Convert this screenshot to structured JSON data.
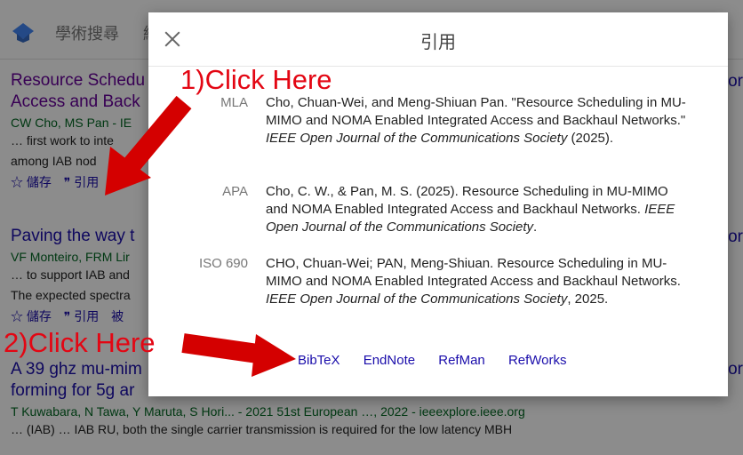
{
  "bg": {
    "brand": "學術搜尋",
    "brand2": "綜",
    "results": [
      {
        "title_1": "Resource Schedu",
        "title_2": "Access and Back",
        "authors": "CW Cho, MS Pan - IE",
        "snip_1": "… first work to inte",
        "snip_2": "among IAB nod",
        "save": "☆ 儲存",
        "cite": "❞ 引用",
        "more": "被"
      },
      {
        "title_1": "Paving the way t",
        "authors": "VF Monteiro, FRM Lir",
        "snip_1": "… to support IAB and",
        "snip_2": "The expected spectra",
        "save": "☆ 儲存",
        "cite": "❞ 引用",
        "more": "被"
      },
      {
        "title_1": "A 39 ghz mu-mim",
        "title_2": "forming for 5g ar",
        "authors": "T Kuwabara, N Tawa, Y Maruta, S Hori... - 2021 51st European …, 2022 - ieeexplore.ieee.org",
        "snip_1": "… (IAB) … IAB RU, both the single carrier transmission is required for the low latency MBH"
      }
    ],
    "right_cut": "or"
  },
  "dialog": {
    "title": "引用",
    "citations": [
      {
        "style": "MLA",
        "text_plain": "Cho, Chuan-Wei, and Meng-Shiuan Pan. \"Resource Scheduling in MU-MIMO and NOMA Enabled Integrated Access and Backhaul Networks.\" ",
        "text_italic": "IEEE Open Journal of the Communications Society",
        "text_tail": " (2025)."
      },
      {
        "style": "APA",
        "text_plain": "Cho, C. W., & Pan, M. S. (2025). Resource Scheduling in MU-MIMO and NOMA Enabled Integrated Access and Backhaul Networks. ",
        "text_italic": "IEEE Open Journal of the Communications Society",
        "text_tail": "."
      },
      {
        "style": "ISO 690",
        "text_plain": "CHO, Chuan-Wei; PAN, Meng-Shiuan. Resource Scheduling in MU-MIMO and NOMA Enabled Integrated Access and Backhaul Networks. ",
        "text_italic": "IEEE Open Journal of the Communications Society",
        "text_tail": ", 2025."
      }
    ],
    "links": [
      "BibTeX",
      "EndNote",
      "RefMan",
      "RefWorks"
    ]
  },
  "annotations": {
    "step1": "1)Click Here",
    "step2": "2)Click Here",
    "arrow_color": "#d40000"
  }
}
